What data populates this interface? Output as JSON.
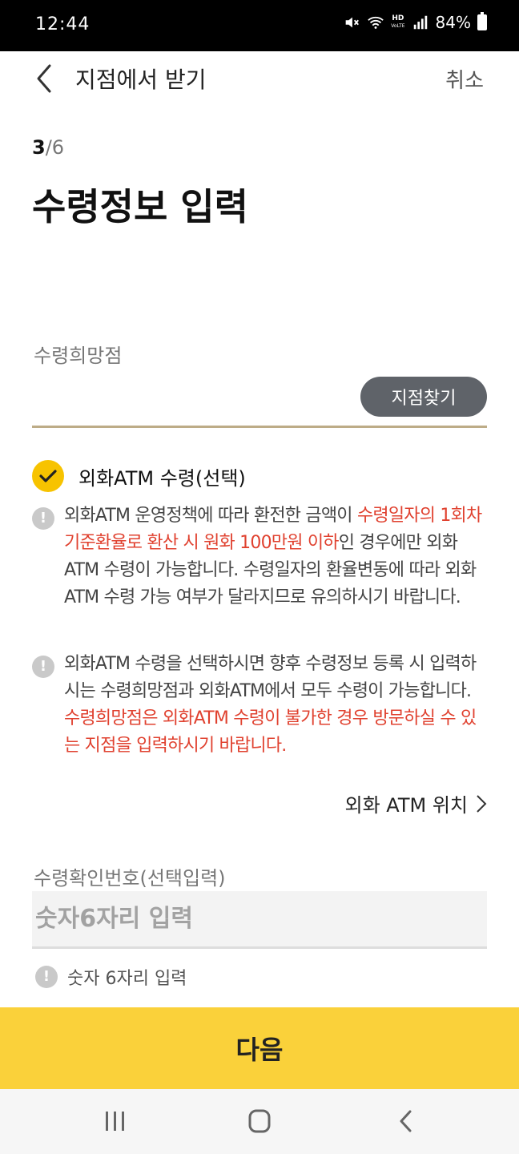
{
  "status_bar": {
    "time": "12:44",
    "hd_label": "HD",
    "voice_label": "VoLTE",
    "battery": "84%"
  },
  "header": {
    "title": "지점에서 받기",
    "cancel_label": "취소"
  },
  "step": {
    "current": "3",
    "separator": "/",
    "total": "6"
  },
  "page_title": "수령정보 입력",
  "branch_field": {
    "label": "수령희망점",
    "find_button_label": "지점찾기"
  },
  "atm_option": {
    "label": "외화ATM 수령(선택)",
    "checked": true
  },
  "notice1": {
    "part1": "외화ATM 운영정책에 따라 환전한 금액이 ",
    "part2_red": "수령일자의 1회차 기준환율로 환산 시 원화 100만원 이하",
    "part3": "인 경우에만 외화ATM 수령이 가능합니다. 수령일자의 환율변동에 따라 외화ATM 수령 가능 여부가 달라지므로 유의하시기 바랍니다."
  },
  "notice2": {
    "part1": "외화ATM 수령을 선택하시면 향후 수령정보 등록 시 입력하시는 수령희망점과 외화ATM에서 모두 수령이 가능합니다. ",
    "part2_red": "수령희망점은 외화ATM 수령이 불가한 경우 방문하실 수 있는 지점을 입력하시기 바랍니다."
  },
  "atm_location_link": "외화 ATM 위치",
  "pin_field": {
    "label": "수령확인번호(선택입력)",
    "placeholder": "숫자6자리 입력",
    "hint": "숫자 6자리 입력"
  },
  "next_button_label": "다음",
  "colors": {
    "accent_yellow": "#fad13a",
    "check_yellow": "#f7c300",
    "warning_red": "#e0412f",
    "button_gray": "#5f6369",
    "underline_gold": "#bdac87"
  }
}
